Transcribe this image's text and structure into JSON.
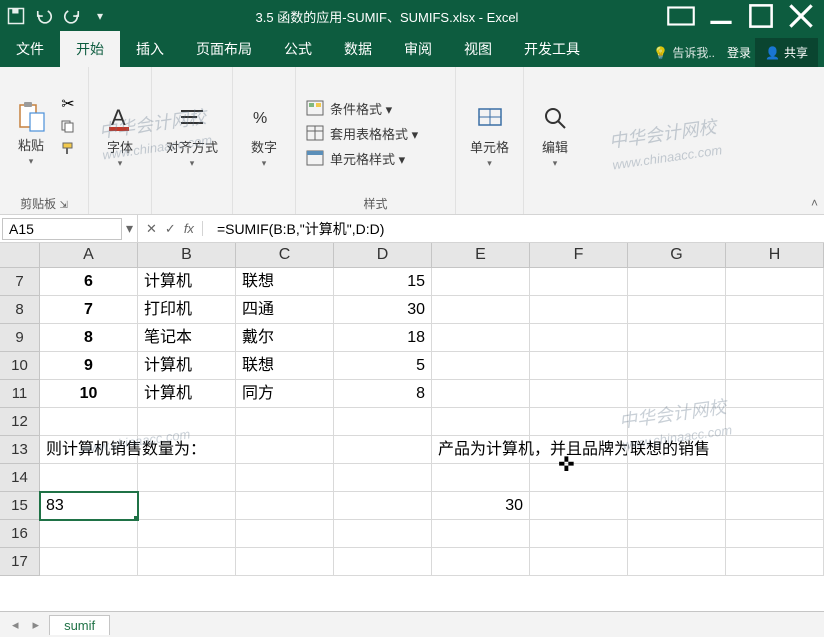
{
  "title": "3.5 函数的应用-SUMIF、SUMIFS.xlsx - Excel",
  "tabs": {
    "file": "文件",
    "home": "开始",
    "insert": "插入",
    "layout": "页面布局",
    "formulas": "公式",
    "data": "数据",
    "review": "审阅",
    "view": "视图",
    "dev": "开发工具",
    "tellme": "告诉我..",
    "signin": "登录",
    "share": "共享"
  },
  "ribbon": {
    "paste": "粘贴",
    "clipboard": "剪贴板",
    "font": "字体",
    "align": "对齐方式",
    "number": "数字",
    "cond_fmt": "条件格式 ▾",
    "table_fmt": "套用表格格式 ▾",
    "cell_styles": "单元格样式 ▾",
    "styles": "样式",
    "cells": "单元格",
    "editing": "编辑"
  },
  "namebox": "A15",
  "formula": "=SUMIF(B:B,\"计算机\",D:D)",
  "columns": [
    "A",
    "B",
    "C",
    "D",
    "E",
    "F",
    "G",
    "H"
  ],
  "rows": [
    {
      "n": "7",
      "A": "6",
      "B": "计算机",
      "C": "联想",
      "D": "15"
    },
    {
      "n": "8",
      "A": "7",
      "B": "打印机",
      "C": "四通",
      "D": "30"
    },
    {
      "n": "9",
      "A": "8",
      "B": "笔记本",
      "C": "戴尔",
      "D": "18"
    },
    {
      "n": "10",
      "A": "9",
      "B": "计算机",
      "C": "联想",
      "D": "5"
    },
    {
      "n": "11",
      "A": "10",
      "B": "计算机",
      "C": "同方",
      "D": "8"
    },
    {
      "n": "12"
    },
    {
      "n": "13",
      "A_text": "则计算机销售数量为：",
      "E_text": "产品为计算机，并且品牌为联想的销售"
    },
    {
      "n": "14"
    },
    {
      "n": "15",
      "A": "83",
      "E": "30",
      "selected": true
    },
    {
      "n": "16"
    },
    {
      "n": "17"
    }
  ],
  "sheet_tab": "sumif",
  "watermark_zh": "中华会计网校",
  "watermark_en": "www.chinaacc.com"
}
